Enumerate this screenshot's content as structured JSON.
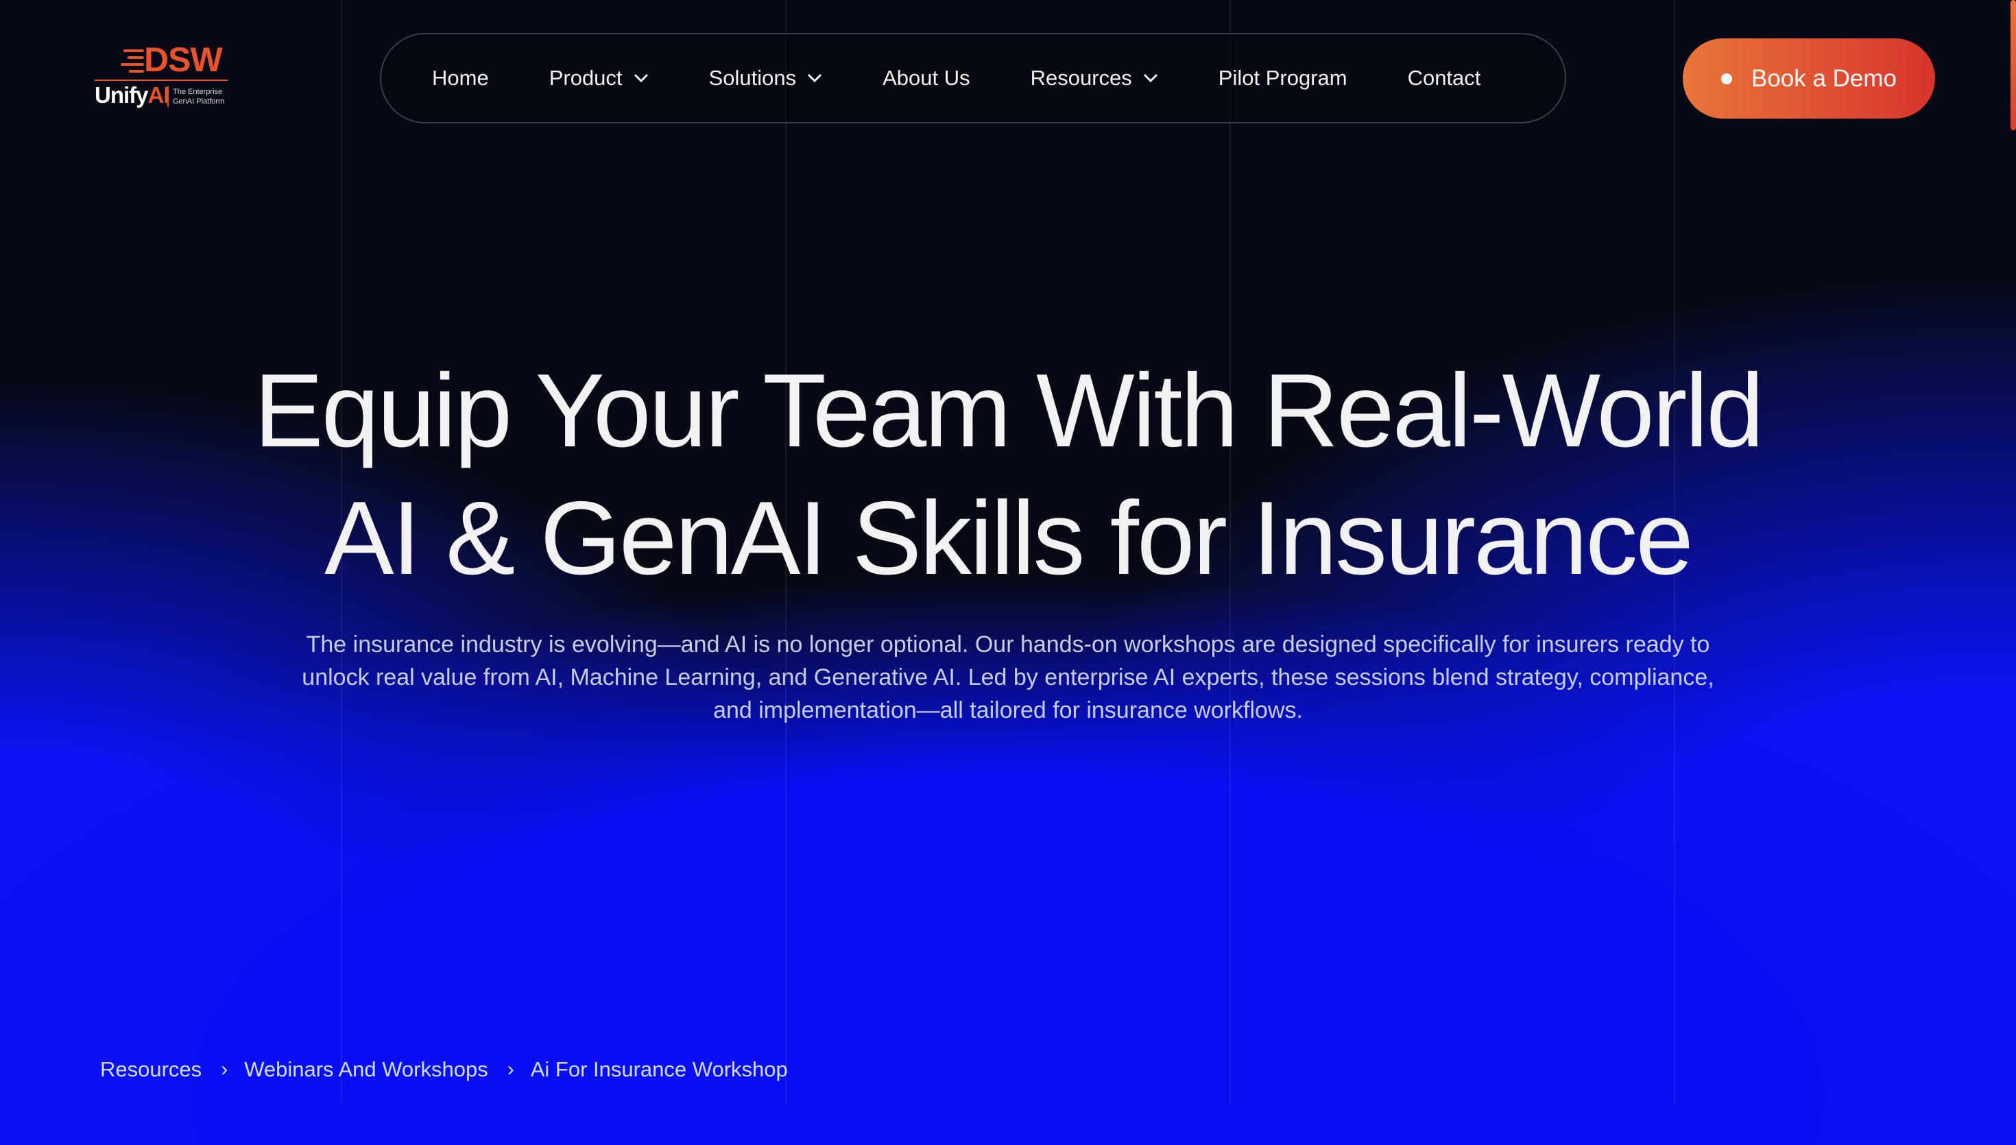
{
  "brand": {
    "logo_mark": "DSW",
    "logo_product": "Unify",
    "logo_product_accent": "AI",
    "tagline_line1": "The Enterprise",
    "tagline_line2": "GenAI Platform",
    "accent_color": "#e8522e"
  },
  "nav": {
    "items": [
      {
        "label": "Home",
        "has_dropdown": false
      },
      {
        "label": "Product",
        "has_dropdown": true
      },
      {
        "label": "Solutions",
        "has_dropdown": true
      },
      {
        "label": "About Us",
        "has_dropdown": false
      },
      {
        "label": "Resources",
        "has_dropdown": true
      },
      {
        "label": "Pilot Program",
        "has_dropdown": false
      },
      {
        "label": "Contact",
        "has_dropdown": false
      }
    ]
  },
  "cta": {
    "label": "Book a Demo",
    "gradient": [
      "#e8763a",
      "#d8342c"
    ]
  },
  "hero": {
    "title_line1": "Equip Your Team With Real-World",
    "title_line2": "AI & GenAI Skills for Insurance",
    "subtitle": "The insurance industry is evolving—and AI is no longer optional. Our hands-on workshops are designed specifically for insurers ready to unlock real value from AI, Machine Learning, and Generative AI. Led by enterprise AI experts, these sessions blend strategy, compliance, and implementation—all tailored for insurance workflows."
  },
  "breadcrumb": {
    "items": [
      "Resources",
      "Webinars And Workshops",
      "Ai For Insurance Workshop"
    ],
    "separator": "›"
  },
  "theme": {
    "background": "#070a14",
    "glow": "#0710f2"
  }
}
